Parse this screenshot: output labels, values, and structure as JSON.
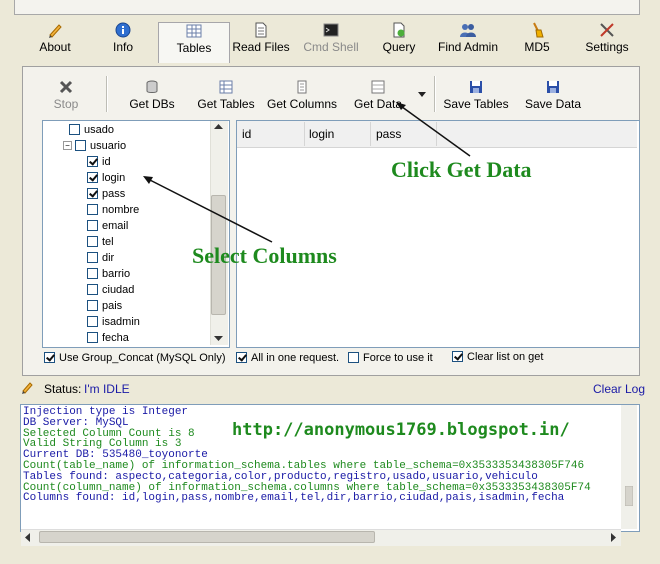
{
  "menu_tabs": [
    {
      "label": "About",
      "icon": "pencil-icon",
      "active": false,
      "disabled": false
    },
    {
      "label": "Info",
      "icon": "info-icon",
      "active": false,
      "disabled": false
    },
    {
      "label": "Tables",
      "icon": "table-icon",
      "active": true,
      "disabled": false
    },
    {
      "label": "Read Files",
      "icon": "document-icon",
      "active": false,
      "disabled": false
    },
    {
      "label": "Cmd Shell",
      "icon": "terminal-icon",
      "active": false,
      "disabled": true
    },
    {
      "label": "Query",
      "icon": "query-icon",
      "active": false,
      "disabled": false
    },
    {
      "label": "Find Admin",
      "icon": "users-icon",
      "active": false,
      "disabled": false
    },
    {
      "label": "MD5",
      "icon": "broom-icon",
      "active": false,
      "disabled": false
    },
    {
      "label": "Settings",
      "icon": "tools-icon",
      "active": false,
      "disabled": false
    }
  ],
  "toolbar": {
    "stop": "Stop",
    "get_dbs": "Get DBs",
    "get_tables": "Get Tables",
    "get_columns": "Get Columns",
    "get_data": "Get Data",
    "save_tables": "Save Tables",
    "save_data": "Save Data"
  },
  "tree": {
    "parent_above": "usado",
    "table": "usuario",
    "columns": [
      {
        "name": "id",
        "checked": true
      },
      {
        "name": "login",
        "checked": true
      },
      {
        "name": "pass",
        "checked": true
      },
      {
        "name": "nombre",
        "checked": false
      },
      {
        "name": "email",
        "checked": false
      },
      {
        "name": "tel",
        "checked": false
      },
      {
        "name": "dir",
        "checked": false
      },
      {
        "name": "barrio",
        "checked": false
      },
      {
        "name": "ciudad",
        "checked": false
      },
      {
        "name": "pais",
        "checked": false
      },
      {
        "name": "isadmin",
        "checked": false
      },
      {
        "name": "fecha",
        "checked": false
      }
    ]
  },
  "grid": {
    "columns": [
      "id",
      "login",
      "pass"
    ]
  },
  "options": {
    "group_concat": {
      "label": "Use Group_Concat (MySQL Only)",
      "checked": true
    },
    "all_in_one": {
      "label": "All in one request.",
      "checked": true
    },
    "force": {
      "label": "Force to use it",
      "checked": false
    },
    "clear_list": {
      "label": "Clear list on get",
      "checked": true
    }
  },
  "status": {
    "label": "Status:",
    "value": "I'm IDLE",
    "clear_log": "Clear Log"
  },
  "log": [
    {
      "text": "Injection type is Integer",
      "color": "#1a1aa6"
    },
    {
      "text": "DB Server: MySQL",
      "color": "#1a1aa6"
    },
    {
      "text": "Selected Column Count is 8",
      "color": "#1e8a1e"
    },
    {
      "text": "Valid String Column is 3",
      "color": "#1e8a1e"
    },
    {
      "text": "Current DB: 535480_toyonorte",
      "color": "#1a1aa6"
    },
    {
      "text": "Count(table_name) of information_schema.tables where table_schema=0x3533353438305F746",
      "color": "#1e8a1e"
    },
    {
      "text": "Tables found: aspecto,categoria,color,producto,registro,usado,usuario,vehiculo",
      "color": "#1a1aa6"
    },
    {
      "text": "Count(column_name) of information_schema.columns where table_schema=0x3533353438305F74",
      "color": "#1e8a1e"
    },
    {
      "text": "Columns found: id,login,pass,nombre,email,tel,dir,barrio,ciudad,pais,isadmin,fecha",
      "color": "#1a1aa6"
    }
  ],
  "annotations": {
    "click_get_data": "Click Get Data",
    "select_columns": "Select Columns",
    "url": "http://anonymous1769.blogspot.in/"
  },
  "colors": {
    "annotation": "#1e8a1e",
    "status_value": "#1a1aa6",
    "link": "#1a1aa6"
  }
}
